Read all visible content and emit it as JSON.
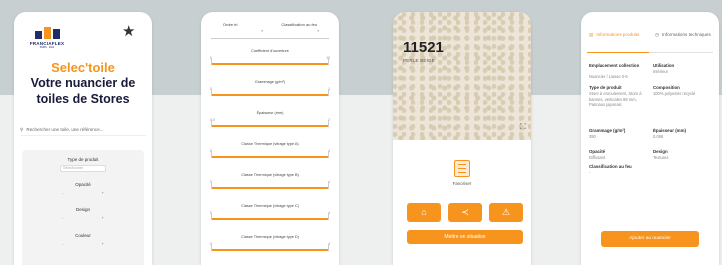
{
  "screen1": {
    "logo_text": "FRANCIAFLEX",
    "logo_sub": "PARIS · 2021",
    "star_icon": "star-icon",
    "title_brand": "Selec'toile",
    "title_line1": "Votre nuancier de",
    "title_line2": "toiles de Stores",
    "search_placeholder": "Rechercher une toile, une référence...",
    "filters": {
      "type_label": "Type de produit",
      "type_value": "Sélectionner",
      "opacity_label": "Opacité",
      "design_label": "Design",
      "color_label": "Couleur"
    }
  },
  "screen2": {
    "sort_label": "Ordre tri",
    "classification_label": "Classification au feu",
    "sliders": [
      {
        "label": "Coefficient d'ouverture",
        "min": "0",
        "max": "10"
      },
      {
        "label": "Grammage (g/m²)",
        "min": "0",
        "max": "1"
      },
      {
        "label": "Épaisseur (mm)",
        "min": "0.0",
        "max": "2"
      },
      {
        "label": "Classe Thermique (vitrage type A)",
        "min": "0",
        "max": "4"
      },
      {
        "label": "Classe Thermique (vitrage type B)",
        "min": "0",
        "max": "4"
      },
      {
        "label": "Classe Thermique (vitrage type C)",
        "min": "0",
        "max": "4"
      },
      {
        "label": "Classe Thermique (vitrage type D)",
        "min": "0",
        "max": "4"
      }
    ]
  },
  "screen3": {
    "reference": "11521",
    "name": "PERLE BEIGE",
    "favorite_label": "Favoriser",
    "actions": [
      "⌂",
      "≺",
      "⚠"
    ],
    "cta": "Mettre en situation",
    "accent": "#f7941d"
  },
  "screen4": {
    "tab1": "Informations produits",
    "tab2": "Informations techniques",
    "fields_left": [
      {
        "label": "Emplacement collection",
        "value": "Nuancier / Liasse 0-5"
      },
      {
        "label": "Type de produit",
        "value": "Store à enroulement, Store à bannes, verticales 89 mm, Pannaux japonais"
      },
      {
        "label": "Grammage (g/m²)",
        "value": "390"
      },
      {
        "label": "Opacité",
        "value": "Diffusant"
      },
      {
        "label": "Classification au feu",
        "value": "-"
      }
    ],
    "fields_right": [
      {
        "label": "Utilisation",
        "value": "Intérieur"
      },
      {
        "label": "Composition",
        "value": "100% polyester recyclé"
      },
      {
        "label": "Épaisseur (mm)",
        "value": "0.058"
      },
      {
        "label": "Design",
        "value": "Textures"
      }
    ],
    "cta": "Ajouter au nuancier"
  }
}
